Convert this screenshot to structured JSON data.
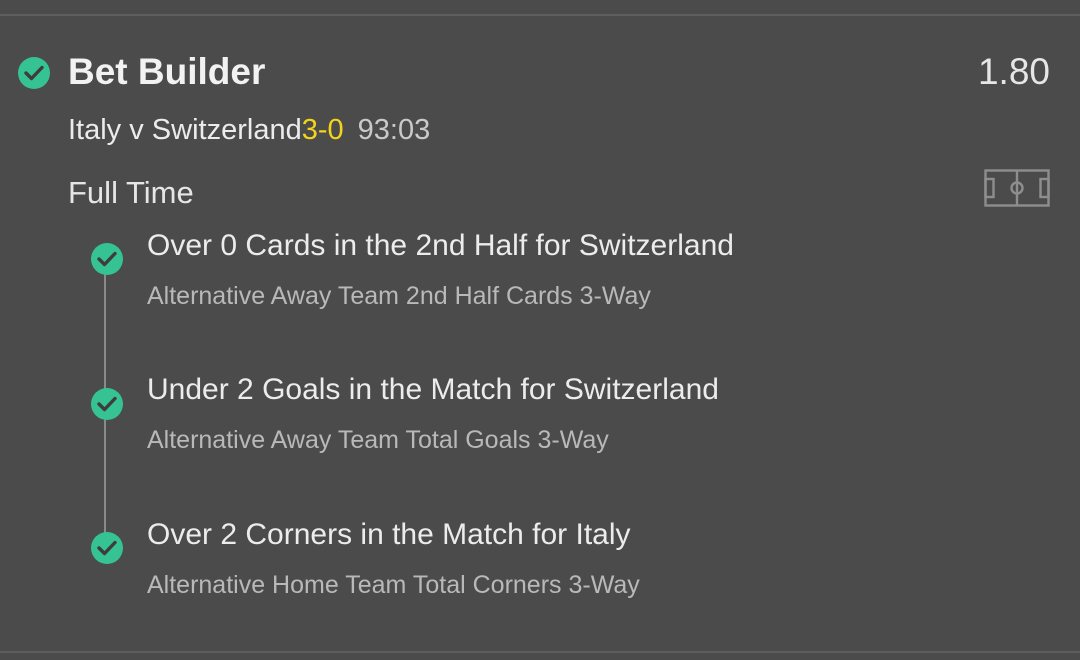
{
  "bet": {
    "title": "Bet Builder",
    "odds": "1.80",
    "status_icon": "check-circle-icon"
  },
  "match": {
    "name": "Italy v Switzerland",
    "score": "3-0",
    "clock": "93:03"
  },
  "period": "Full Time",
  "pitch_icon": "football-pitch-icon",
  "selections": [
    {
      "title": "Over 0 Cards in the 2nd Half for Switzerland",
      "market": "Alternative Away Team 2nd Half Cards 3-Way",
      "status_icon": "check-circle-icon"
    },
    {
      "title": "Under 2 Goals in the Match for Switzerland",
      "market": "Alternative Away Team Total Goals 3-Way",
      "status_icon": "check-circle-icon"
    },
    {
      "title": "Over 2 Corners in the Match for Italy",
      "market": "Alternative Home Team Total Corners 3-Way",
      "status_icon": "check-circle-icon"
    }
  ],
  "colors": {
    "background": "#4b4b4b",
    "check_green": "#35c393",
    "score_yellow": "#f3d41c"
  }
}
